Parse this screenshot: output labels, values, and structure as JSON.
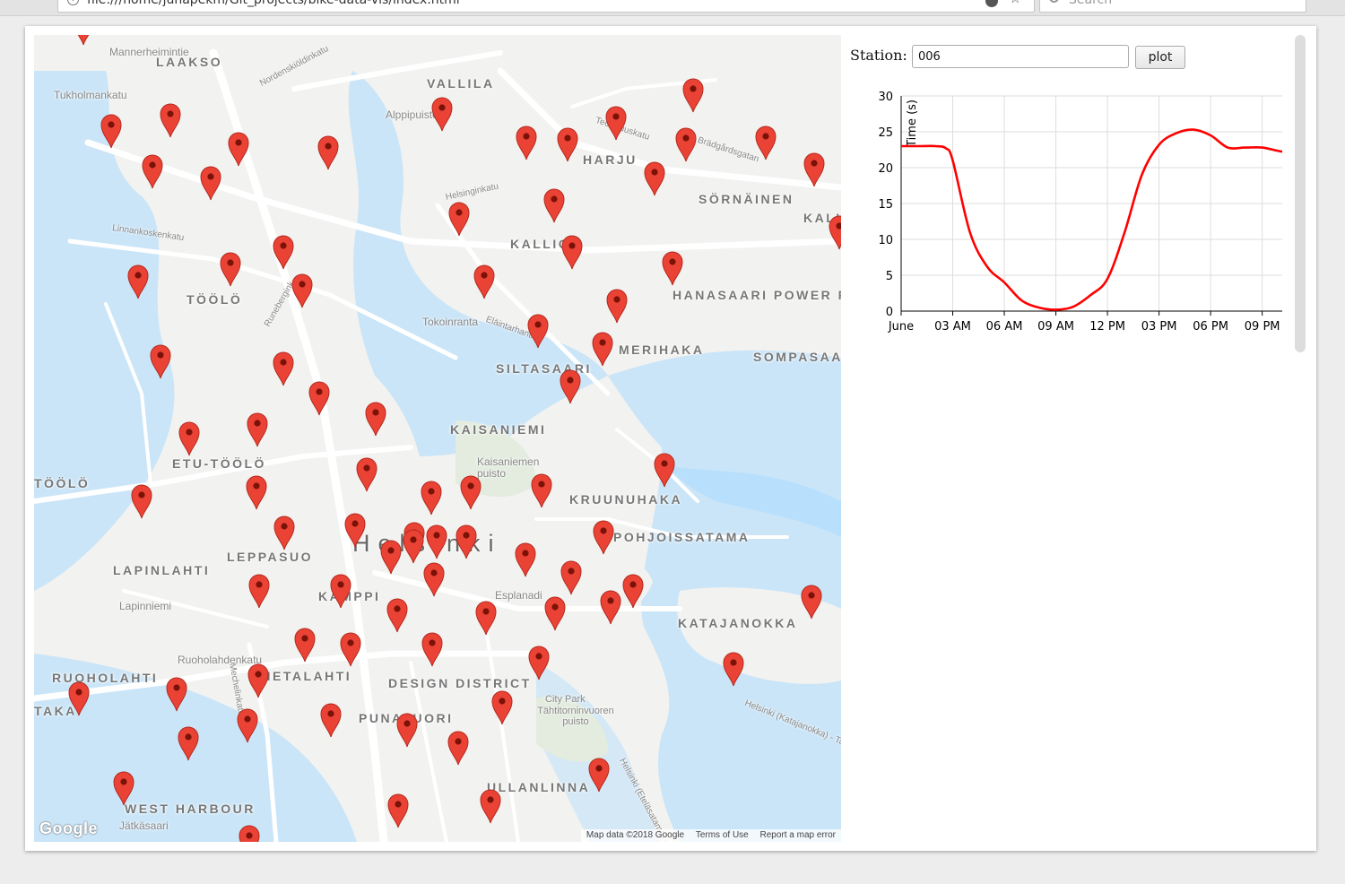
{
  "browser": {
    "url": "file:///home/juhapekm/Git_projects/bike-data-vis/index.html",
    "search_placeholder": "Search"
  },
  "map": {
    "district_labels": [
      "LAAKSO",
      "VALLILA",
      "HARJU",
      "KALLIO",
      "SÖRNÄINEN",
      "TÖÖLÖ",
      "HANASAARI POWER PLANT",
      "MERIHAKA",
      "SILTASAARI",
      "SOMPASAARI",
      "KAISANIEMI",
      "ETU-TÖÖLÖ",
      "RUOHOLAHTI",
      "KRUUNUHAKA",
      "POHJOISSATAMA",
      "KAMPPI",
      "LAPINLAHTI",
      "LEPPASUO",
      "KATAJANOKKA",
      "HIETALAHTI",
      "PUNAVUORI",
      "DESIGN DISTRICT",
      "ULLANLINNA",
      "WEST HARBOUR",
      "KALLIO",
      "TÖÖLÖ",
      "TAKA-TÖÖLÖ"
    ],
    "city_label": "Helsinki",
    "small_labels": [
      "Tukholmankatu",
      "Alppipuisto",
      "Nordenskiöldinkatu",
      "Tokoinranta",
      "Eläintarhantie",
      "Lapinniemi",
      "Esplanadi",
      "Kaisaniemen puisto",
      "City Park",
      "Tähtitorninvuoren puisto",
      "Jätkäsaari",
      "Helsinginkatu",
      "Linnankoskenkatu",
      "Brädgårdsgatan",
      "Teollisuuskatu",
      "Runebergink",
      "Mechelinkatu",
      "Ruoholahdenkatu",
      "Helsinki (Katajanokka) - Ta",
      "Helsinki (Eteläsatama) - Ahvenanmaa",
      "Mannerheimintie"
    ],
    "attribution": {
      "map_data": "Map data ©2018 Google",
      "terms": "Terms of Use",
      "report": "Report a map error"
    },
    "google_logo": "Google",
    "marker_color": "#ea4335",
    "marker_count": 94
  },
  "controls": {
    "station_label": "Station:",
    "station_value": "006",
    "plot_label": "plot"
  },
  "chart_data": {
    "type": "line",
    "ylabel": "Time (s)",
    "xlabel": "",
    "ylim": [
      0,
      30
    ],
    "yticks": [
      "0",
      "5",
      "10",
      "15",
      "20",
      "25",
      "30"
    ],
    "xticks": [
      "June",
      "03 AM",
      "06 AM",
      "09 AM",
      "12 PM",
      "03 PM",
      "06 PM",
      "09 PM"
    ],
    "xtick_hours": [
      0,
      3,
      6,
      9,
      12,
      15,
      18,
      21
    ],
    "xlim_hours": [
      0,
      23
    ],
    "line_color": "#ff0000",
    "grid": true,
    "series": [
      {
        "x_hours": [
          0,
          1,
          2,
          2.6,
          3,
          4,
          5,
          6,
          7,
          8,
          9,
          10,
          11,
          12,
          13,
          14,
          15,
          16,
          17,
          18,
          19,
          20,
          21,
          22,
          23
        ],
        "values": [
          23,
          23,
          23,
          22.7,
          21,
          11,
          6.2,
          4,
          1.5,
          0.5,
          0.2,
          0.6,
          2.2,
          4.5,
          11,
          19,
          23.2,
          24.8,
          25.3,
          24.5,
          22.8,
          22.8,
          22.8,
          22.3,
          22
        ]
      }
    ]
  }
}
